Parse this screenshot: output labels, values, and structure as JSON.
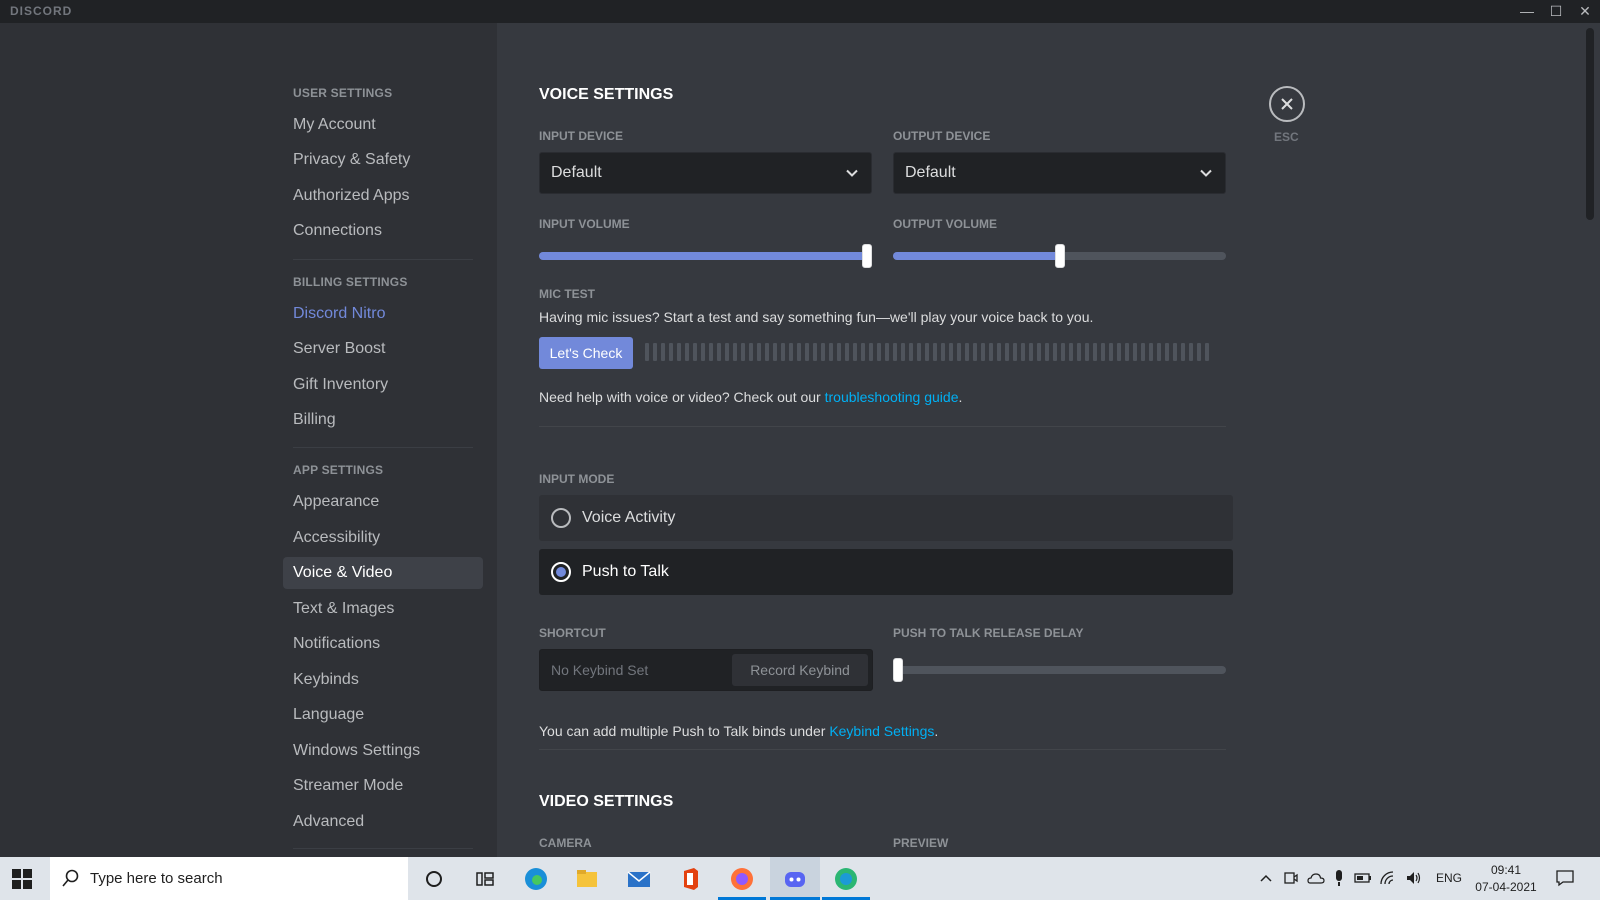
{
  "titlebar": {
    "app_name": "DISCORD",
    "minimize": "—",
    "maximize": "☐",
    "close": "✕"
  },
  "sidebar": {
    "user_settings_header": "USER SETTINGS",
    "user_items": [
      "My Account",
      "Privacy & Safety",
      "Authorized Apps",
      "Connections"
    ],
    "billing_settings_header": "BILLING SETTINGS",
    "billing_items": [
      "Discord Nitro",
      "Server Boost",
      "Gift Inventory",
      "Billing"
    ],
    "app_settings_header": "APP SETTINGS",
    "app_items": [
      "Appearance",
      "Accessibility",
      "Voice & Video",
      "Text & Images",
      "Notifications",
      "Keybinds",
      "Language",
      "Windows Settings",
      "Streamer Mode",
      "Advanced"
    ],
    "active_item": "Voice & Video"
  },
  "voice": {
    "title": "VOICE SETTINGS",
    "input_device_label": "INPUT DEVICE",
    "input_device_value": "Default",
    "output_device_label": "OUTPUT DEVICE",
    "output_device_value": "Default",
    "input_volume_label": "INPUT VOLUME",
    "input_volume_level": 1.0,
    "output_volume_label": "OUTPUT VOLUME",
    "output_volume_level": 0.5,
    "mic_test_label": "MIC TEST",
    "mic_test_desc": "Having mic issues? Start a test and say something fun—we'll play your voice back to you.",
    "lets_check": "Let's Check",
    "help_prefix": "Need help with voice or video? Check out our ",
    "help_link": "troubleshooting guide",
    "help_suffix": ".",
    "input_mode_label": "INPUT MODE",
    "modes": [
      "Voice Activity",
      "Push to Talk"
    ],
    "selected_mode": "Push to Talk",
    "shortcut_label": "SHORTCUT",
    "shortcut_placeholder": "No Keybind Set",
    "record_keybind": "Record Keybind",
    "ptt_delay_label": "PUSH TO TALK RELEASE DELAY",
    "ptt_delay_level": 0.0,
    "ptt_note_prefix": "You can add multiple Push to Talk binds under ",
    "ptt_note_link": "Keybind Settings",
    "ptt_note_suffix": "."
  },
  "video": {
    "title": "VIDEO SETTINGS",
    "camera_label": "CAMERA",
    "preview_label": "PREVIEW"
  },
  "close": {
    "esc_label": "ESC"
  },
  "taskbar": {
    "search_placeholder": "Type here to search",
    "lang": "ENG",
    "time": "09:41",
    "date": "07-04-2021",
    "pinned": [
      "cortana-icon",
      "task-view-icon",
      "edge-icon",
      "file-explorer-icon",
      "mail-icon",
      "office-icon",
      "firefox-icon",
      "discord-icon",
      "app-icon"
    ]
  },
  "colors": {
    "accent": "#7289da",
    "link": "#00b0f4",
    "sidebar_bg": "#2f3136",
    "main_bg": "#36393f"
  }
}
